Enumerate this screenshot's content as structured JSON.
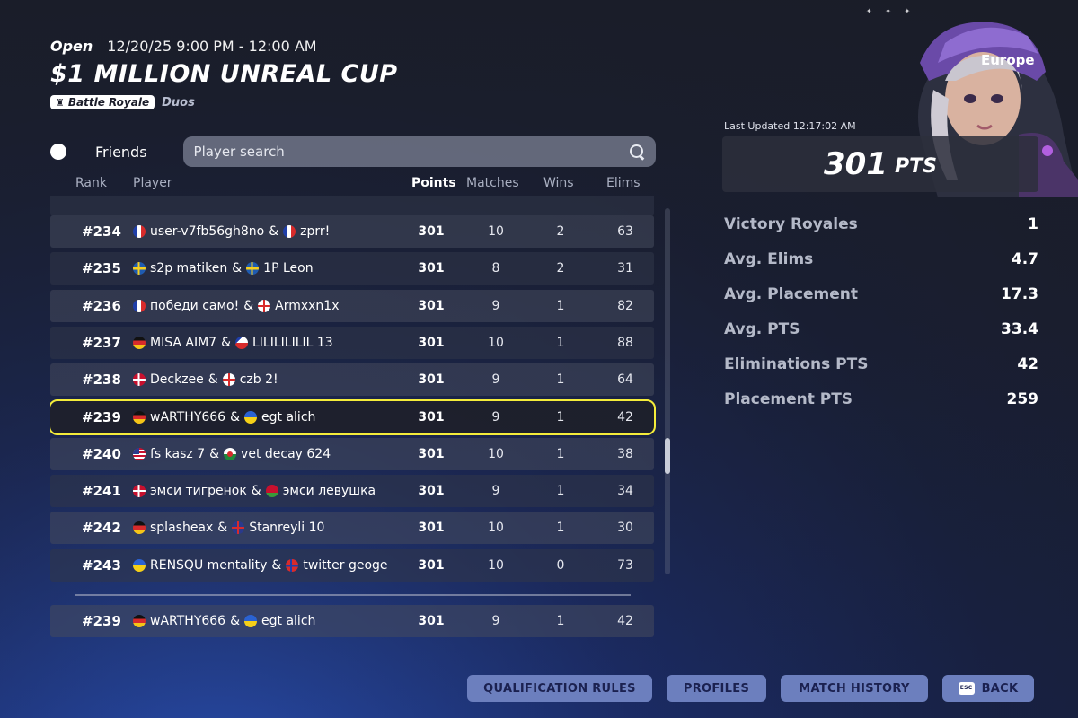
{
  "header": {
    "status": "Open",
    "datetime": "12/20/25 9:00 PM - 12:00 AM",
    "title": "$1 MILLION UNREAL CUP",
    "mode_badge": "Battle Royale",
    "team_size": "Duos"
  },
  "filters": {
    "friends_label": "Friends",
    "search_placeholder": "Player search"
  },
  "columns": {
    "rank": "Rank",
    "player": "Player",
    "points": "Points",
    "matches": "Matches",
    "wins": "Wins",
    "elims": "Elims"
  },
  "rows": [
    {
      "rank": "#234",
      "p1": "user-v7fb56gh8no",
      "f1": "fr",
      "p2": "zprr!",
      "f2": "fr",
      "points": "301",
      "matches": "10",
      "wins": "2",
      "elims": "63"
    },
    {
      "rank": "#235",
      "p1": "s2p matiken",
      "f1": "se",
      "p2": "1P Leon",
      "f2": "se",
      "points": "301",
      "matches": "8",
      "wins": "2",
      "elims": "31"
    },
    {
      "rank": "#236",
      "p1": "победи само!",
      "f1": "fr",
      "p2": "Armxxn1x",
      "f2": "en",
      "points": "301",
      "matches": "9",
      "wins": "1",
      "elims": "82"
    },
    {
      "rank": "#237",
      "p1": "MISA AIM7",
      "f1": "de",
      "p2": "LILILILILIL 13",
      "f2": "cz",
      "points": "301",
      "matches": "10",
      "wins": "1",
      "elims": "88"
    },
    {
      "rank": "#238",
      "p1": "Deckzee",
      "f1": "dk",
      "p2": "czb 2!",
      "f2": "en",
      "points": "301",
      "matches": "9",
      "wins": "1",
      "elims": "64"
    },
    {
      "rank": "#239",
      "p1": "wARTHY666",
      "f1": "de",
      "p2": "egt alich",
      "f2": "ua",
      "points": "301",
      "matches": "9",
      "wins": "1",
      "elims": "42"
    },
    {
      "rank": "#240",
      "p1": "fs kasz 7",
      "f1": "us",
      "p2": "vet decay 624",
      "f2": "wa",
      "points": "301",
      "matches": "10",
      "wins": "1",
      "elims": "38"
    },
    {
      "rank": "#241",
      "p1": "эмси тигренок",
      "f1": "dk",
      "p2": "эмси левушка",
      "f2": "by",
      "points": "301",
      "matches": "9",
      "wins": "1",
      "elims": "34"
    },
    {
      "rank": "#242",
      "p1": "splasheax",
      "f1": "de",
      "p2": "Stanreyli 10",
      "f2": "gb",
      "points": "301",
      "matches": "10",
      "wins": "1",
      "elims": "30"
    },
    {
      "rank": "#243",
      "p1": "RENSQU mentality",
      "f1": "ua",
      "p2": "twitter geoge",
      "f2": "no",
      "points": "301",
      "matches": "10",
      "wins": "0",
      "elims": "73"
    }
  ],
  "self_row": {
    "rank": "#239",
    "p1": "wARTHY666",
    "f1": "de",
    "p2": "egt alich",
    "f2": "ua",
    "points": "301",
    "matches": "9",
    "wins": "1",
    "elims": "42"
  },
  "highlight_index": 5,
  "panel": {
    "region": "Europe",
    "last_updated": "Last Updated 12:17:02 AM",
    "points_value": "301",
    "points_unit": "PTS",
    "stats": [
      {
        "label": "Victory Royales",
        "value": "1"
      },
      {
        "label": "Avg. Elims",
        "value": "4.7"
      },
      {
        "label": "Avg. Placement",
        "value": "17.3"
      },
      {
        "label": "Avg. PTS",
        "value": "33.4"
      },
      {
        "label": "Eliminations PTS",
        "value": "42"
      },
      {
        "label": "Placement PTS",
        "value": "259"
      }
    ]
  },
  "buttons": {
    "qualification": "QUALIFICATION RULES",
    "profiles": "PROFILES",
    "match_history": "MATCH HISTORY",
    "back": "BACK",
    "esc_key": "ESC"
  },
  "colors": {
    "highlight": "#f4ec3a",
    "button_bg": "#6c7fbe"
  }
}
